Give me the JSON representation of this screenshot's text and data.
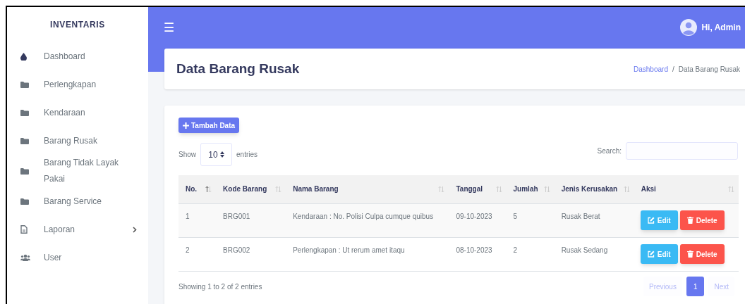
{
  "sidebar": {
    "brand": "INVENTARIS",
    "items": [
      {
        "kind": "drop",
        "label": "Dashboard"
      },
      {
        "kind": "folder",
        "label": "Perlengkapan"
      },
      {
        "kind": "folder",
        "label": "Kendaraan"
      },
      {
        "kind": "folder",
        "label": "Barang Rusak"
      },
      {
        "kind": "folder",
        "label": "Barang Tidak Layak Pakai"
      },
      {
        "kind": "folder",
        "label": "Barang Service"
      },
      {
        "kind": "file",
        "label": "Laporan",
        "expandable": true
      },
      {
        "kind": "users",
        "label": "User"
      }
    ]
  },
  "navbar": {
    "menu_icon": "☰",
    "user": "Hi, Admin"
  },
  "header": {
    "title": "Data Barang Rusak",
    "breadcrumb_separator": "/",
    "breadcrumb": [
      {
        "label": "Dashboard",
        "link": true
      },
      {
        "label": "Data Barang Rusak",
        "link": false
      }
    ]
  },
  "card": {
    "add_button": "Tambah Data",
    "show_label": "Show",
    "page_size": "10",
    "entries_label": "entries",
    "search_label": "Search:",
    "table": {
      "columns": [
        {
          "label": "No.",
          "sorted": true
        },
        {
          "label": "Kode Barang",
          "sorted": false
        },
        {
          "label": "Nama Barang",
          "sorted": false
        },
        {
          "label": "Tanggal",
          "sorted": false
        },
        {
          "label": "Jumlah",
          "sorted": false
        },
        {
          "label": "Jenis Kerusakan",
          "sorted": false
        },
        {
          "label": "Aksi",
          "sorted": false
        }
      ],
      "rows": [
        {
          "cells": [
            "1",
            "BRG001",
            "Kendaraan : No. Polisi Culpa cumque quibus",
            "09-10-2023",
            "5",
            "Rusak Berat"
          ],
          "actions": [
            "Edit",
            "Delete"
          ]
        },
        {
          "cells": [
            "2",
            "BRG002",
            "Perlengkapan : Ut rerum amet itaqu",
            "08-10-2023",
            "2",
            "Rusak Sedang"
          ],
          "actions": [
            "Edit",
            "Delete"
          ]
        }
      ]
    },
    "info": "Showing 1 to 2 of 2 entries",
    "pagination": [
      {
        "label": "Previous",
        "kind": "nav",
        "disabled": true,
        "selected": false
      },
      {
        "label": "1",
        "kind": "page",
        "selected": true
      },
      {
        "label": "Next",
        "kind": "nav",
        "disabled": true,
        "selected": false
      }
    ]
  }
}
